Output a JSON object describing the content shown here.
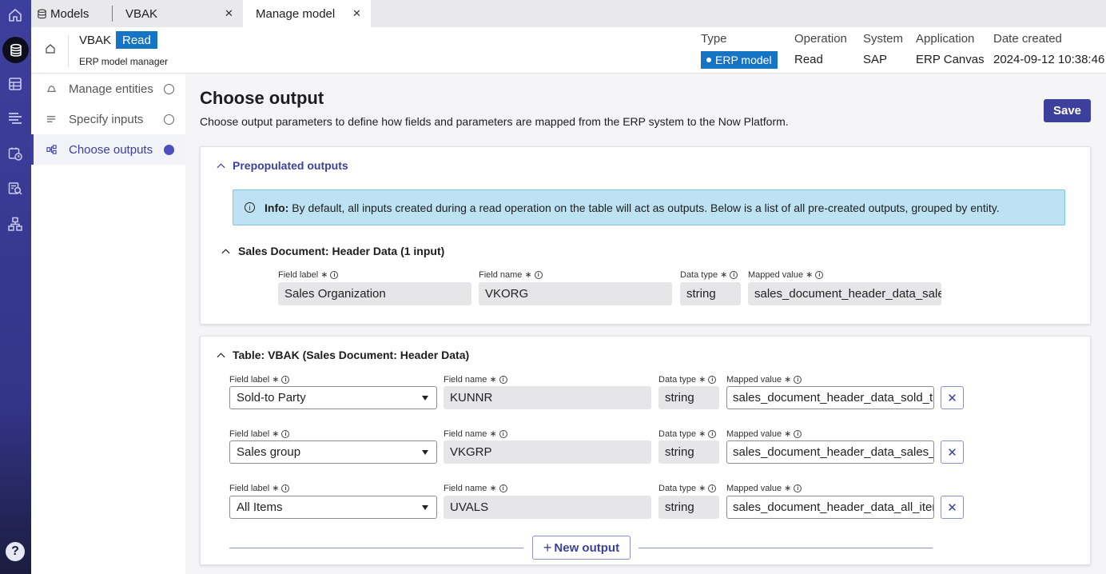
{
  "tabs": {
    "models": "Models",
    "vbak": "VBAK",
    "manage": "Manage model"
  },
  "header": {
    "name": "VBAK",
    "badge": "Read",
    "subtitle": "ERP model manager",
    "cols": {
      "type_label": "Type",
      "type_value": "ERP model",
      "op_label": "Operation",
      "op_value": "Read",
      "sys_label": "System",
      "sys_value": "SAP",
      "app_label": "Application",
      "app_value": "ERP Canvas",
      "date_label": "Date created",
      "date_value": "2024-09-12 10:38:46"
    }
  },
  "sidebar": {
    "items": [
      {
        "label": "Manage entities"
      },
      {
        "label": "Specify inputs"
      },
      {
        "label": "Choose outputs"
      }
    ]
  },
  "main": {
    "title": "Choose output",
    "desc": "Choose output parameters to define how fields and parameters are mapped from the ERP system to the Now Platform.",
    "save": "Save"
  },
  "prepop": {
    "title": "Prepopulated outputs",
    "info_bold": "Info:",
    "info_text": " By default, all inputs created during a read operation on the table will act as outputs. Below is a list of all pre-created outputs, grouped by entity.",
    "group": "Sales Document: Header Data (1 input)",
    "labels": {
      "field_label": "Field label",
      "field_name": "Field name",
      "data_type": "Data type",
      "mapped_value": "Mapped value"
    },
    "row": {
      "field_label": "Sales Organization",
      "field_name": "VKORG",
      "data_type": "string",
      "mapped_value": "sales_document_header_data_sales_"
    }
  },
  "table": {
    "title": "Table: VBAK (Sales Document: Header Data)",
    "labels": {
      "field_label": "Field label",
      "field_name": "Field name",
      "data_type": "Data type",
      "mapped_value": "Mapped value"
    },
    "rows": [
      {
        "field_label": "Sold-to Party",
        "field_name": "KUNNR",
        "data_type": "string",
        "mapped_value": "sales_document_header_data_sold_to_"
      },
      {
        "field_label": "Sales group",
        "field_name": "VKGRP",
        "data_type": "string",
        "mapped_value": "sales_document_header_data_sales_gro"
      },
      {
        "field_label": "All Items",
        "field_name": "UVALS",
        "data_type": "string",
        "mapped_value": "sales_document_header_data_all_items"
      }
    ],
    "new_output": "New output"
  },
  "colors": {
    "accent": "#3d3f9c",
    "badge": "#1574c4",
    "info_bg": "#bde3f2"
  }
}
